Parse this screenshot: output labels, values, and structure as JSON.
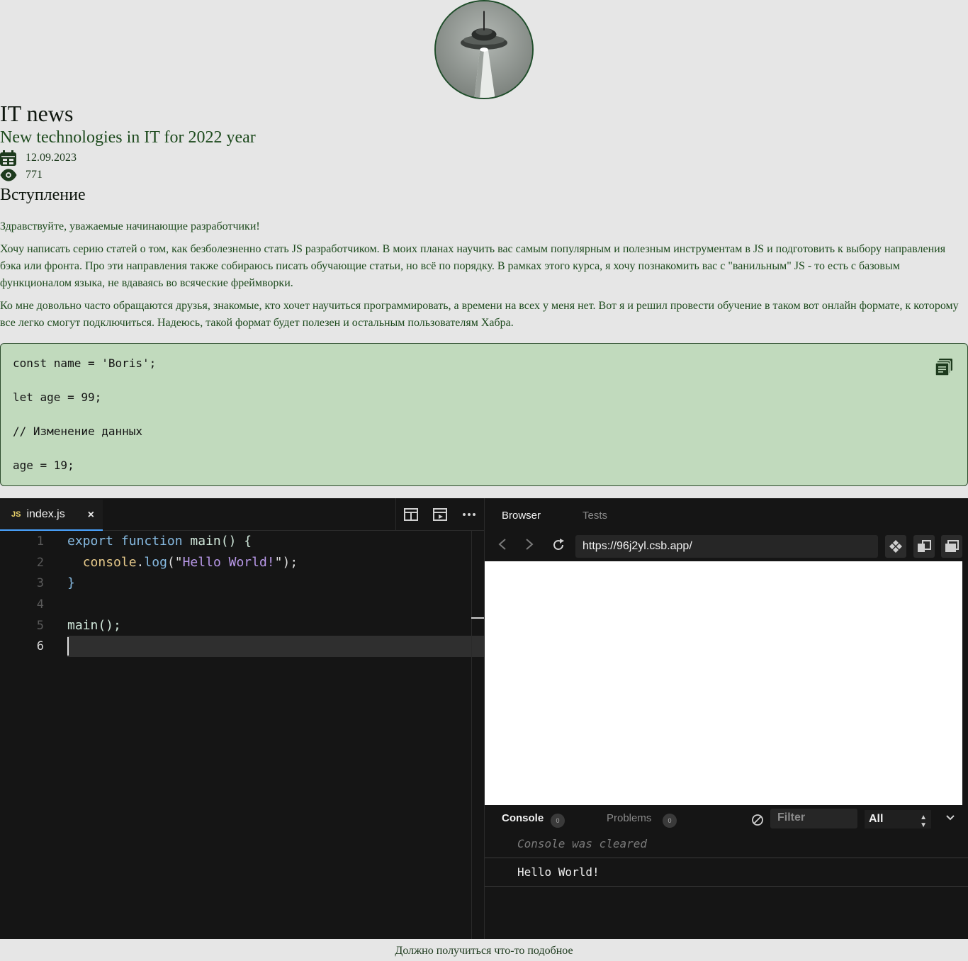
{
  "header": {
    "site_title": "IT news",
    "article_title": "New technologies in IT for 2022 year"
  },
  "meta": {
    "date": "12.09.2023",
    "views": "771",
    "date_icon": "calendar-icon",
    "views_icon": "eye-icon"
  },
  "section": {
    "title": "Вступление"
  },
  "paragraphs": [
    "Здравствуйте, уважаемые начинающие разработчики!",
    "Хочу написать серию статей о том, как безболезненно стать JS разработчиком. В моих планах научить вас самым популярным и полезным инструментам в JS и подготовить к выбору направления бэка или фронта. Про эти направления также собираюсь писать обучающие статьи, но всё по порядку. В рамках этого курса, я хочу познакомить вас с \"ванильным\" JS - то есть с базовым функционалом языка, не вдаваясь во всяческие фреймворки.",
    "Ко мне довольно часто обращаются друзья, знакомые, кто хочет научиться программировать, а времени на всех у меня нет. Вот я и решил провести обучение в таком вот онлайн формате, к которому все легко смогут подключиться. Надеюсь, такой формат будет полезен и остальным пользователям Хабра."
  ],
  "code_block": {
    "lines": [
      "const name = 'Boris';",
      "let age = 99;",
      "// Изменение данных",
      "age = 19;"
    ],
    "copy_icon": "copy-icon"
  },
  "editor": {
    "tab_badge": "JS",
    "tab_name": "index.js",
    "tab_close": "×",
    "line_numbers": [
      "1",
      "2",
      "3",
      "4",
      "5",
      "6"
    ],
    "code": {
      "l1_kw1": "export",
      "l1_kw2": "function",
      "l1_fn": "main",
      "l1_rest": "() {",
      "l2_obj": "console",
      "l2_dot": ".",
      "l2_fn": "log",
      "l2_open": "(\"",
      "l2_str": "Hello World!",
      "l2_close": "\");",
      "l3": "}",
      "l5": "main();"
    }
  },
  "browser": {
    "tabs": [
      "Browser",
      "Tests"
    ],
    "url": "https://96j2yl.csb.app/",
    "console_tabs": [
      "Console",
      "Problems"
    ],
    "console_count": "0",
    "problems_count": "0",
    "filter_placeholder": "Filter",
    "level": "All",
    "logs": [
      "Console was cleared",
      "Hello World!"
    ]
  },
  "caption": "Должно получиться что-то подобное"
}
